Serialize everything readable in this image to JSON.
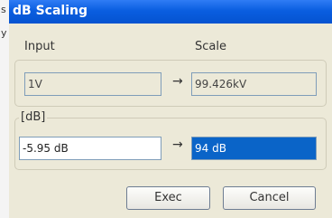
{
  "background_strip": {
    "chars": [
      "s",
      "y"
    ]
  },
  "window": {
    "title": "dB Scaling"
  },
  "scale_group": {
    "input_label": "Input",
    "scale_label": "Scale",
    "input_value": "1V",
    "arrow": "→",
    "scale_value": "99.426kV"
  },
  "db_group": {
    "legend": "[dB]",
    "input_value": "-5.95 dB",
    "arrow": "→",
    "output_value": "94 dB"
  },
  "buttons": {
    "exec": "Exec",
    "cancel": "Cancel"
  },
  "colors": {
    "titlebar": "#0a5ee0",
    "selection": "#0a64c8",
    "dialog_bg": "#ece9d8"
  }
}
